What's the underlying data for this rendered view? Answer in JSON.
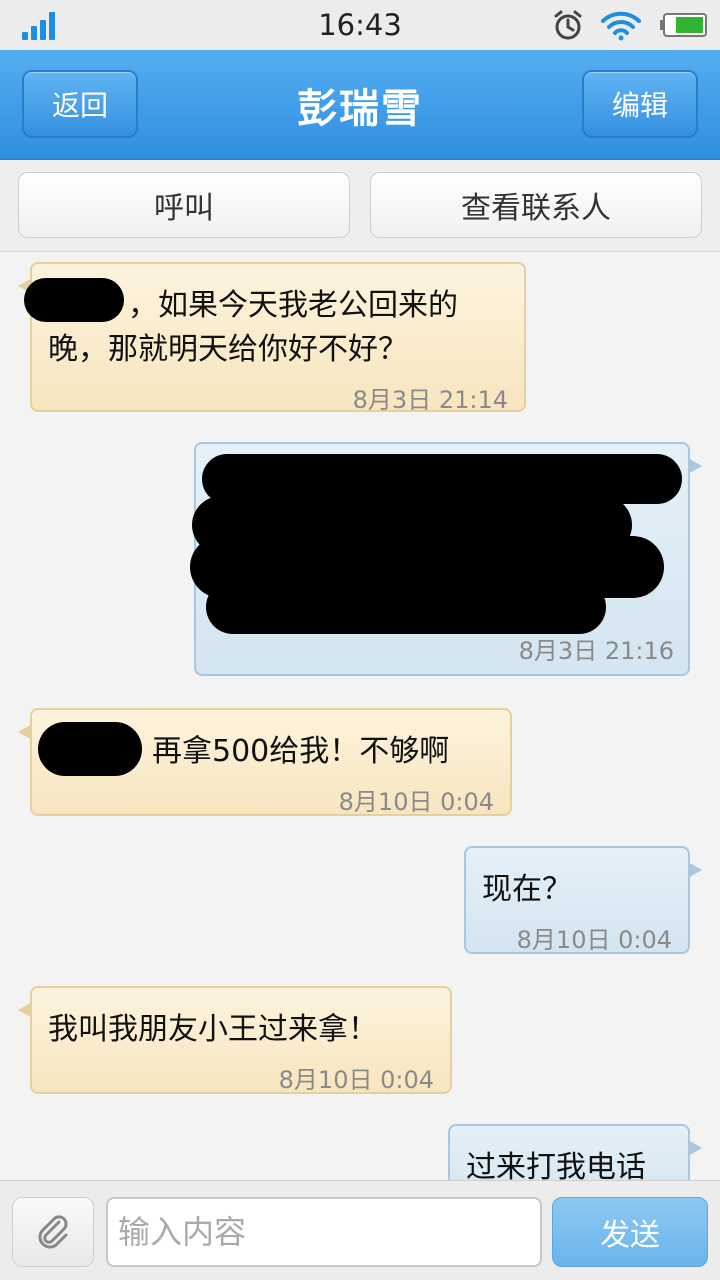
{
  "status_bar": {
    "time": "16:43"
  },
  "header": {
    "title": "彭瑞雪",
    "back_label": "返回",
    "edit_label": "编辑"
  },
  "actions": {
    "call_label": "呼叫",
    "view_contact_label": "查看联系人"
  },
  "messages": [
    {
      "direction": "in",
      "text": "，如果今天我老公回来的晚，那就明天给你好不好？",
      "time": "8月3日 21:14"
    },
    {
      "direction": "out",
      "text": "",
      "time": "8月3日 21:16"
    },
    {
      "direction": "in",
      "text": "再拿500给我！不够啊",
      "time": "8月10日 0:04"
    },
    {
      "direction": "out",
      "text": "现在？",
      "time": "8月10日 0:04"
    },
    {
      "direction": "in",
      "text": "我叫我朋友小王过来拿！",
      "time": "8月10日 0:04"
    },
    {
      "direction": "out",
      "text": "过来打我电话",
      "time": ""
    }
  ],
  "input": {
    "placeholder": "输入内容",
    "send_label": "发送"
  },
  "colors": {
    "header_blue": "#3a97e3",
    "incoming_bubble": "#f9ebcc",
    "outgoing_bubble": "#dbe9f4"
  }
}
